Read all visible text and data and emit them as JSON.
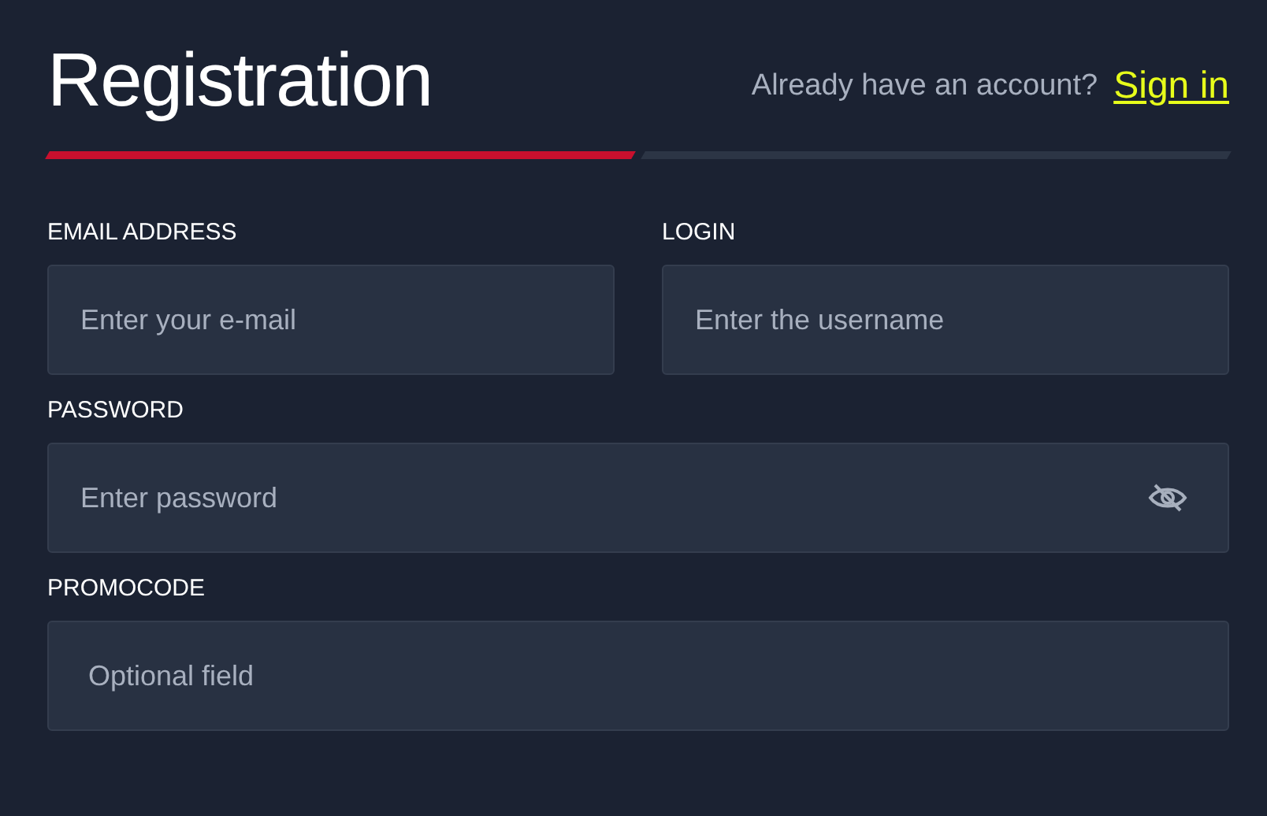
{
  "title": "Registration",
  "signin": {
    "prompt": "Already have an account?",
    "link": "Sign in"
  },
  "steps": [
    {
      "selected": true
    },
    {
      "selected": false
    }
  ],
  "fields": [
    {
      "label": "EMAIL ADDRESS",
      "placeholder": "Enter your e-mail",
      "kind": "half"
    },
    {
      "label": "LOGIN",
      "placeholder": "Enter the username",
      "kind": "half"
    },
    {
      "label": "PASSWORD",
      "placeholder": "Enter password",
      "kind": "password"
    },
    {
      "label": "PROMOCODE",
      "placeholder": "Optional field",
      "kind": "full"
    }
  ]
}
